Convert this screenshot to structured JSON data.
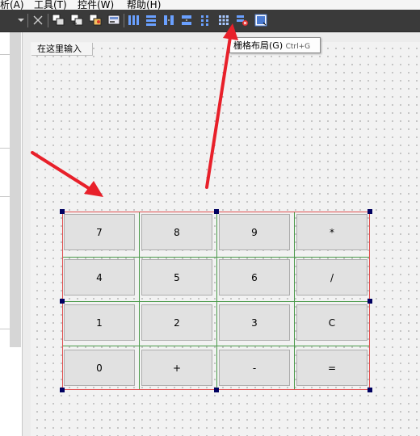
{
  "menubar": {
    "items": [
      "析(A)",
      "工具(T)",
      "控件(W)",
      "帮助(H)"
    ]
  },
  "toolbar": {
    "icons": [
      "dropdown-arrow-icon",
      "break-layout-icon",
      "edit-widgets-icon",
      "edit-signals-slots-icon",
      "edit-buddies-icon",
      "edit-tab-order-icon",
      "horizontal-layout-icon",
      "vertical-layout-icon",
      "horizontal-splitter-icon",
      "vertical-splitter-icon",
      "form-layout-icon",
      "grid-layout-icon",
      "break-layout-red-icon",
      "adjust-size-icon"
    ]
  },
  "form": {
    "title": "在这里输入"
  },
  "tooltip": {
    "label": "栅格布局(G)",
    "shortcut": "Ctrl+G"
  },
  "calculator": {
    "buttons": [
      "7",
      "8",
      "9",
      "*",
      "4",
      "5",
      "6",
      "/",
      "1",
      "2",
      "3",
      "C",
      "0",
      "+",
      "-",
      "="
    ]
  },
  "colors": {
    "toolbar_bg": "#3a3a3a",
    "annotation_arrow": "#e8202a",
    "layout_border": "#e05050",
    "grid_line": "#4a9a4a",
    "handle": "#000060"
  }
}
